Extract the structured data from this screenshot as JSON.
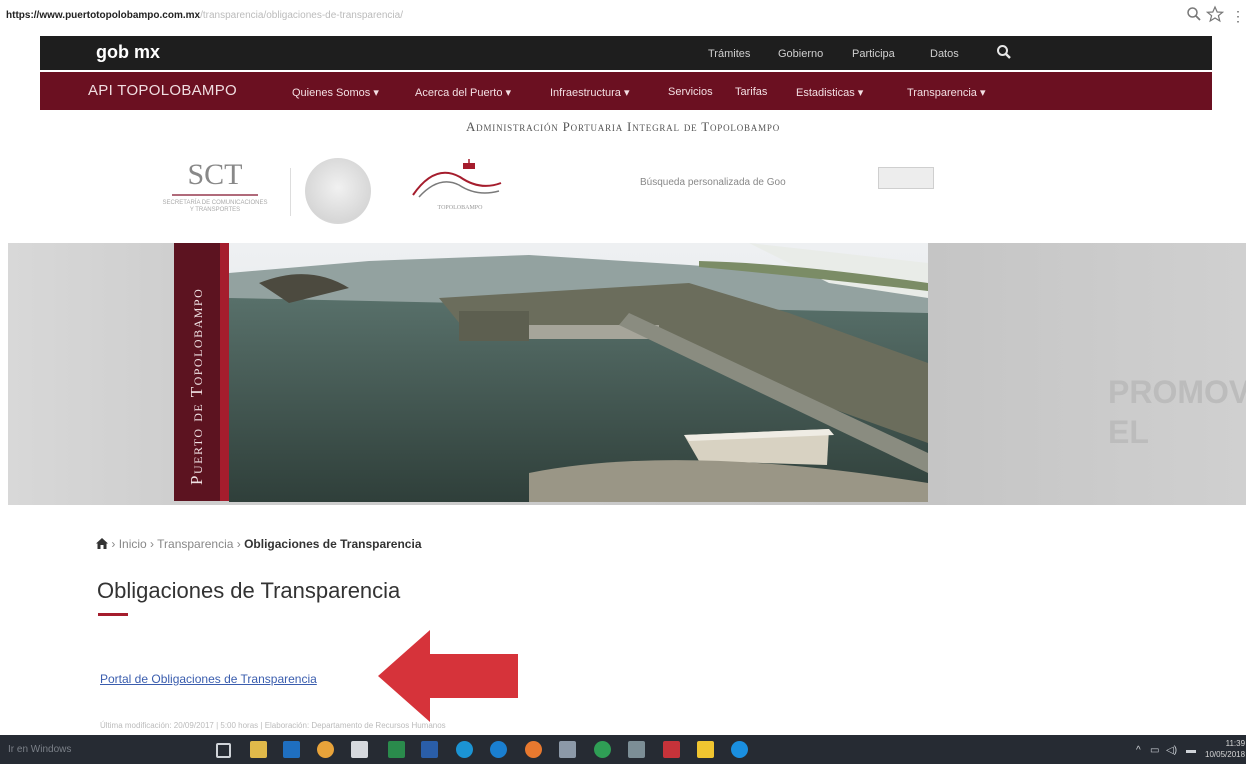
{
  "browser": {
    "url_domain": "https://www.puertotopolobampo.com.mx",
    "url_path": "/transparencia/obligaciones-de-transparencia/"
  },
  "gobbar": {
    "logo": "gob mx",
    "links": [
      "Trámites",
      "Gobierno",
      "Participa",
      "Datos"
    ]
  },
  "apinav": {
    "title": "API TOPOLOBAMPO",
    "items": [
      "Quienes Somos ▾",
      "Acerca del Puerto ▾",
      "Infraestructura ▾",
      "Servicios",
      "Tarifas",
      "Estadisticas ▾",
      "Transparencia ▾"
    ]
  },
  "header": {
    "title": "Administración Portuaria Integral de Topolobampo",
    "sct_text": "SCT",
    "sct_subtitle": "Secretaría de Comunicaciones y Transportes",
    "port_logo_text": "TOPOLOBAMPO",
    "search_label": "Búsqueda personalizada de Goo"
  },
  "hero": {
    "vertical_text": "Puerto de Topolobampo",
    "ghost_text": "PROMOVER EL"
  },
  "breadcrumb": {
    "items": [
      "Inicio",
      "Transparencia"
    ],
    "current": "Obligaciones de Transparencia"
  },
  "main": {
    "title": "Obligaciones de Transparencia",
    "portal_link": "Portal de Obligaciones de Transparencia",
    "last_modified": "Última modificación: 20/09/2017 | 5:00 horas | Elaboración: Departamento de Recursos Humanos"
  },
  "taskbar": {
    "search_text": "Ir en Windows",
    "time": "11:39",
    "date": "10/05/2018"
  },
  "colors": {
    "gob_bar": "#1e1e1e",
    "api_bar": "#6b1021",
    "accent": "#a51d2d",
    "link": "#3a5dae",
    "arrow": "#d6333a"
  }
}
